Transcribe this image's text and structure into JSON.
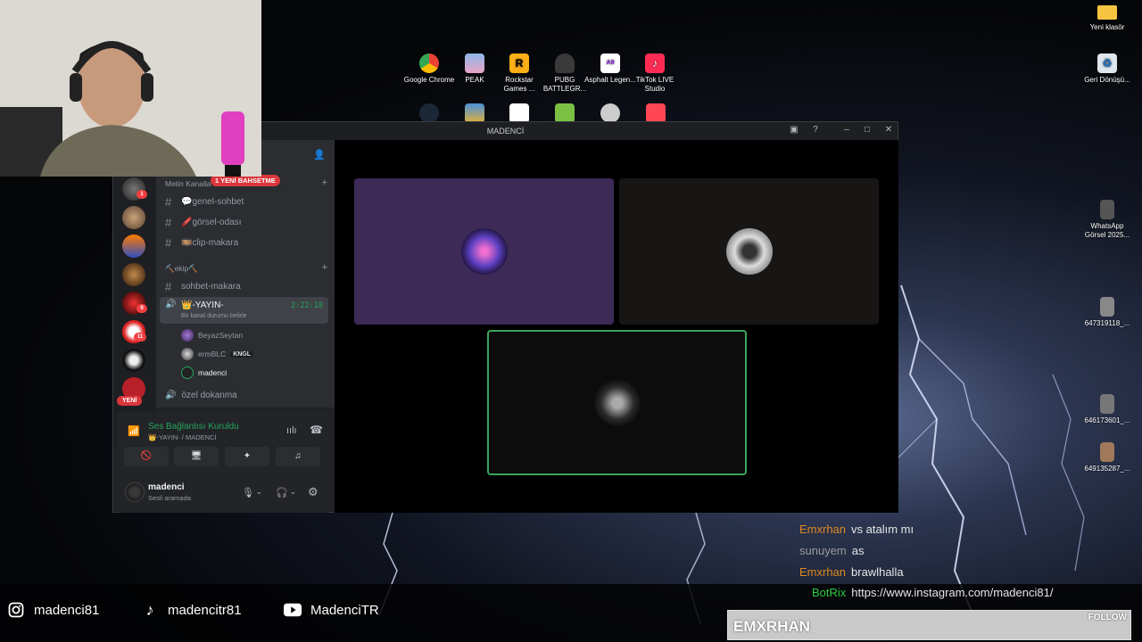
{
  "desktop": {
    "top_icons": [
      {
        "label": "Google Chrome",
        "icon": "chrome-icon"
      },
      {
        "label": "PEAK",
        "icon": "peak-icon"
      },
      {
        "label": "Rockstar Games ...",
        "icon": "rockstar-icon"
      },
      {
        "label": "PUBG BATTLEGR...",
        "icon": "pubg-icon"
      },
      {
        "label": "Asphalt Legen...",
        "icon": "asphalt-icon"
      },
      {
        "label": "TikTok LIVE Studio",
        "icon": "tiktok-live-icon"
      }
    ],
    "right_icons": [
      {
        "label": "Yeni klasör",
        "icon": "folder-icon"
      },
      {
        "label": "Geri Dönüşü...",
        "icon": "recycle-bin-icon"
      },
      {
        "label": "WhatsApp Görsel 2025...",
        "icon": "image-file-icon"
      },
      {
        "label": "647319118_...",
        "icon": "image-file-icon"
      },
      {
        "label": "646173601_...",
        "icon": "image-file-icon"
      },
      {
        "label": "649135287_...",
        "icon": "image-file-icon"
      }
    ]
  },
  "discord": {
    "window_title": "MADENCİ",
    "server_badges": [
      "1",
      "9",
      "11"
    ],
    "categories": {
      "first": "Metin Kanalla",
      "second": "⛏️ekip⛏️"
    },
    "text_channels": [
      {
        "label": "💬genel-sohbet"
      },
      {
        "label": "🖍️görsel-odası"
      },
      {
        "label": "🎞️clip-makara"
      }
    ],
    "channel_sohbet": "sohbet-makara",
    "voice_active": {
      "name": "👑-YAYIN-",
      "status_hint": "Bir kanal durumu belirle",
      "timer": "2:22:18"
    },
    "voice_users": [
      {
        "name": "BeyazSeytan",
        "tag": ""
      },
      {
        "name": "ermBLC",
        "tag": "KNGL"
      },
      {
        "name": "madenci",
        "tag": ""
      }
    ],
    "voice_other": "özel dokanma",
    "mention_pill": "1 YENİ BAHSETME",
    "new_pill": "YENİ",
    "connection": {
      "title": "Ses Bağlantısı Kuruldu",
      "subtitle": "👑-YAYIN- / MADENCİ"
    },
    "me": {
      "name": "madenci",
      "status": "Sesli aramada"
    }
  },
  "socials": [
    {
      "icon": "instagram-icon",
      "handle": "madenci81"
    },
    {
      "icon": "tiktok-icon",
      "handle": "madencitr81"
    },
    {
      "icon": "youtube-icon",
      "handle": "MadenciTR"
    }
  ],
  "chat": [
    {
      "user": "Emxrhan",
      "text": "vs atalım mı",
      "color": "#e08a1e"
    },
    {
      "user": "sunuyem",
      "text": "as",
      "color": "#9a9a9a"
    },
    {
      "user": "Emxrhan",
      "text": "brawlhalla",
      "color": "#e08a1e"
    },
    {
      "user": "BotRix",
      "text": "https://www.instagram.com/madenci81/",
      "color": "#2ecc40"
    }
  ],
  "follow": {
    "name": "EMXRHAN",
    "label": "FOLLOW"
  },
  "colors": {
    "discord_green": "#23a55a",
    "discord_red": "#da373c",
    "tile_purple": "#3d2a57",
    "active_border": "#3ba55d"
  }
}
